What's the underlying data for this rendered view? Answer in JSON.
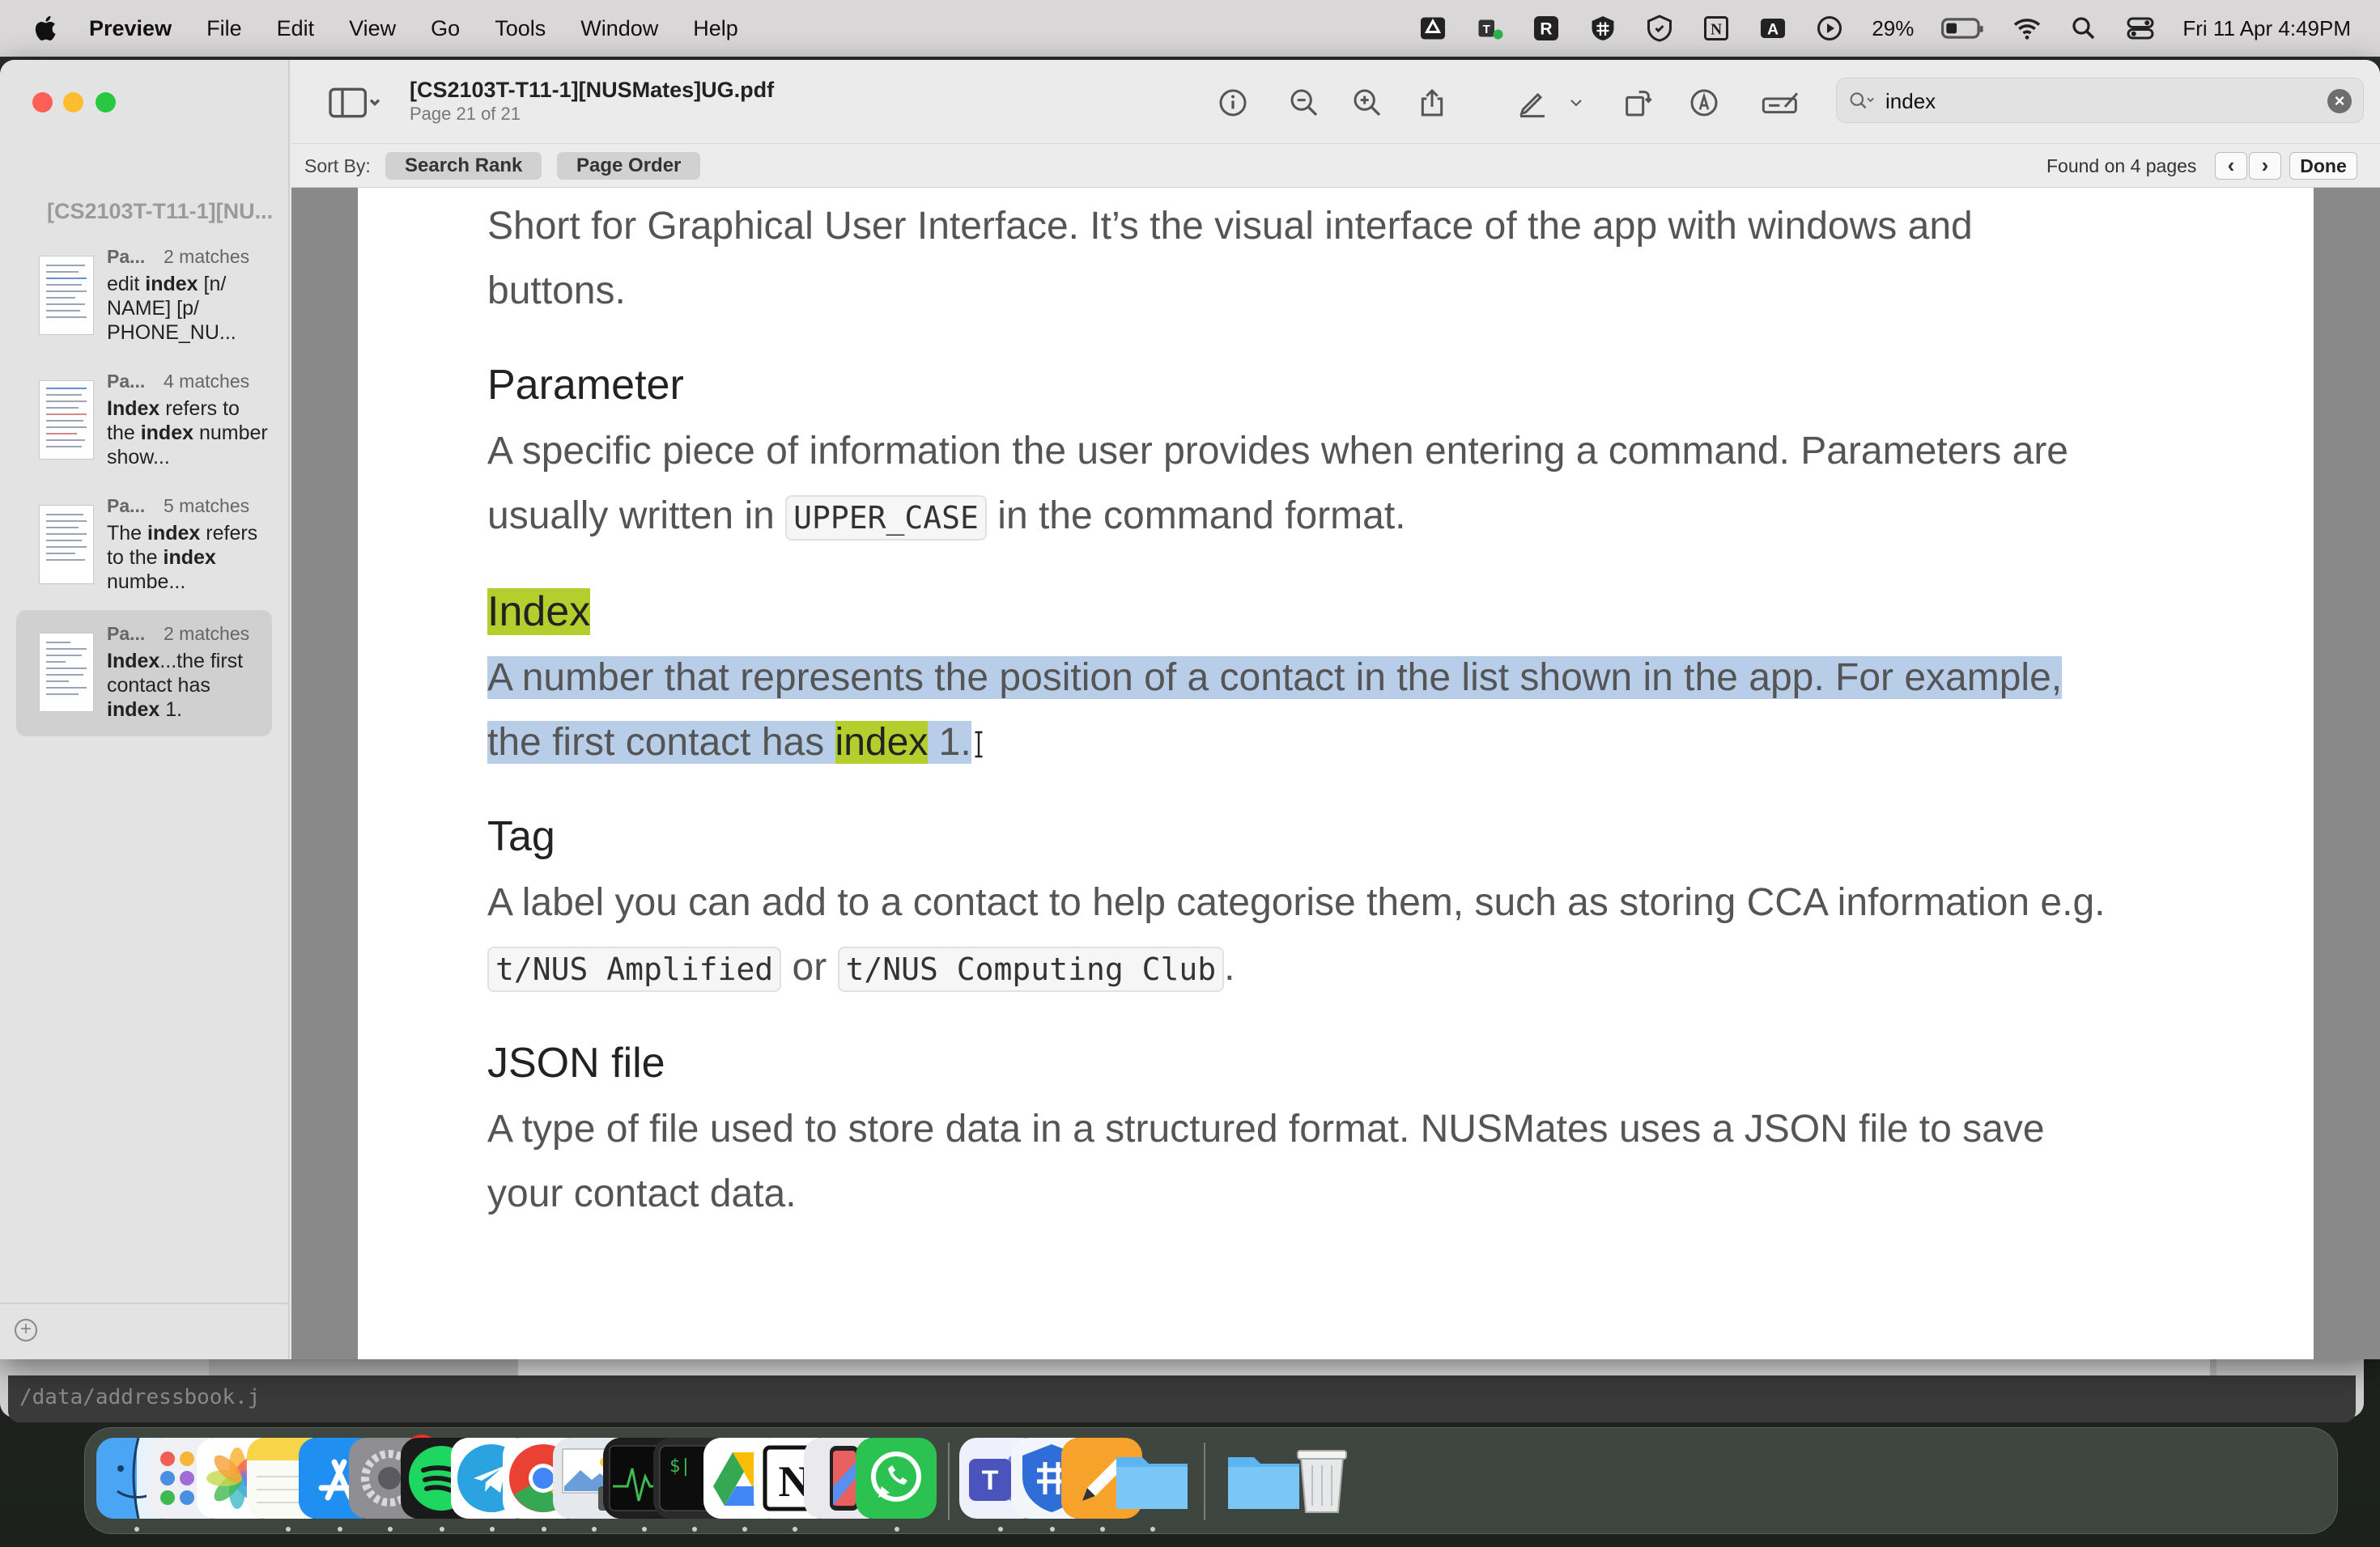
{
  "menubar": {
    "app": "Preview",
    "items": [
      "File",
      "Edit",
      "View",
      "Go",
      "Tools",
      "Window",
      "Help"
    ],
    "battery": "29%",
    "datetime": "Fri 11 Apr  4:49PM"
  },
  "window": {
    "doc_title": "[CS2103T-T11-1][NUSMates]UG.pdf",
    "doc_subtitle": "Page 21 of 21",
    "search_value": "index",
    "sort_label": "Sort By:",
    "sort_rank": "Search Rank",
    "sort_order": "Page Order",
    "found": "Found on 4 pages",
    "done": "Done"
  },
  "sidebar": {
    "title": "[CS2103T-T11-1][NU...",
    "results": [
      {
        "page": "Pa...",
        "matches": "2 matches",
        "s1": "edit ",
        "b1": "index",
        "s2": " [n/ NAME] [p/ PHONE_NU...",
        "b2": "",
        "s3": "",
        "b3": "",
        "s4": ""
      },
      {
        "page": "Pa...",
        "matches": "4 matches",
        "s1": "",
        "b1": "Index",
        "s2": " refers to the ",
        "b2": "index",
        "s3": " number show...",
        "b3": "",
        "s4": ""
      },
      {
        "page": "Pa...",
        "matches": "5 matches",
        "s1": "The ",
        "b1": "index",
        "s2": " refers to the ",
        "b2": "index",
        "s3": " numbe...",
        "b3": "",
        "s4": ""
      },
      {
        "page": "Pa...",
        "matches": "2 matches",
        "s1": "",
        "b1": "Index",
        "s2": "...the first contact has ",
        "b2": "index",
        "s3": " 1.",
        "b3": "",
        "s4": ""
      }
    ]
  },
  "document": {
    "gui_line1": "Short for Graphical User Interface. It’s the visual interface of the app with windows and",
    "gui_line2": "buttons.",
    "param_heading": "Parameter",
    "param_line1": "A specific piece of information the user provides when entering a command. Parameters are",
    "param_line2a": "usually written in ",
    "param_code": "UPPER_CASE",
    "param_line2b": " in the command format.",
    "index_heading": "Index",
    "index_line1": "A number that represents the position of a contact in the list shown in the app. For example,",
    "index_line2a": "the first contact has ",
    "index_hl": "index",
    "index_line2b": " 1.",
    "tag_heading": "Tag",
    "tag_line1": "A label you can add to a contact to help categorise them, such as storing CCA information e.g.",
    "tag_code1": "t/NUS Amplified",
    "tag_or": " or ",
    "tag_code2": "t/NUS Computing Club",
    "tag_end": ".",
    "json_heading": "JSON file",
    "json_line1": "A type of file used to store data in a structured format. NUSMates uses a JSON file to save",
    "json_line2": "your contact data."
  },
  "background": {
    "terminal_text": "/data/addressbook.j"
  },
  "dock": {
    "badge": "1"
  },
  "colors": {
    "highlight": "#b4ce2d",
    "selection": "#b7cde8"
  }
}
